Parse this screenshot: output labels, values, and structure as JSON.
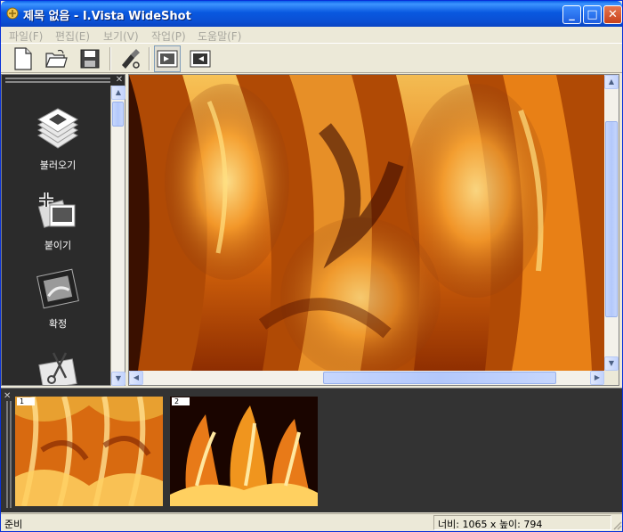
{
  "window": {
    "title": "제목 없음 - I.Vista WideShot",
    "controls": {
      "minimize": "_",
      "maximize": "□",
      "close": "✕"
    }
  },
  "menu": [
    "파일(F)",
    "편집(E)",
    "보기(V)",
    "작업(P)",
    "도움말(F)"
  ],
  "toolbar": {
    "tools": [
      "new-file-icon",
      "open-folder-icon",
      "save-icon",
      "settings-tool-icon",
      "view-mode-1-icon",
      "view-mode-2-icon"
    ]
  },
  "left_panel": {
    "items": [
      {
        "label": "불러오기",
        "icon": "load-images-icon"
      },
      {
        "label": "붙이기",
        "icon": "paste-images-icon"
      },
      {
        "label": "확정",
        "icon": "confirm-film-icon"
      },
      {
        "label": "",
        "icon": "cut-scissors-icon"
      }
    ]
  },
  "thumbnails": [
    {
      "num": "1"
    },
    {
      "num": "2"
    }
  ],
  "statusbar": {
    "status": "준비",
    "dimensions": "너비:  1065 x 높이:    794"
  },
  "colors": {
    "title_bar": "#0A5FE8",
    "panel_bg": "#2B2B2B",
    "flame_orange": "#F07A10"
  }
}
